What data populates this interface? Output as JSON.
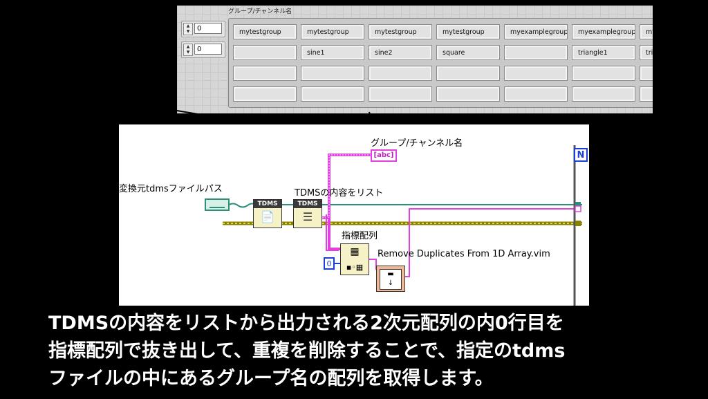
{
  "inset": {
    "label": "グループ/チャンネル名",
    "index_values": [
      "0",
      "0"
    ],
    "rows": [
      [
        "mytestgroup",
        "mytestgroup",
        "mytestgroup",
        "mytestgroup",
        "myexamplegroup",
        "myexamplegroup",
        "my"
      ],
      [
        "",
        "sine1",
        "sine2",
        "square",
        "",
        "triangle1",
        "tria"
      ],
      [
        "",
        "",
        "",
        "",
        "",
        "",
        ""
      ],
      [
        "",
        "",
        "",
        "",
        "",
        "",
        ""
      ]
    ]
  },
  "diagram": {
    "label_channel": "グループ/チャンネル名",
    "indicator_text": "[abc]",
    "label_path": "変換元tdmsファイルパス",
    "label_list": "TDMSの内容をリスト",
    "tdms_header": "TDMS",
    "label_index": "指標配列",
    "constant_zero": "0",
    "label_remove": "Remove Duplicates From 1D Array.vim",
    "loop_tag": "N"
  },
  "caption": {
    "line1": "TDMSの内容をリストから出力される2次元配列の内0行目を",
    "line2": "指標配列で抜き出して、重複を削除することで、指定のtdms",
    "line3": "ファイルの中にあるグループ名の配列を取得します。"
  }
}
